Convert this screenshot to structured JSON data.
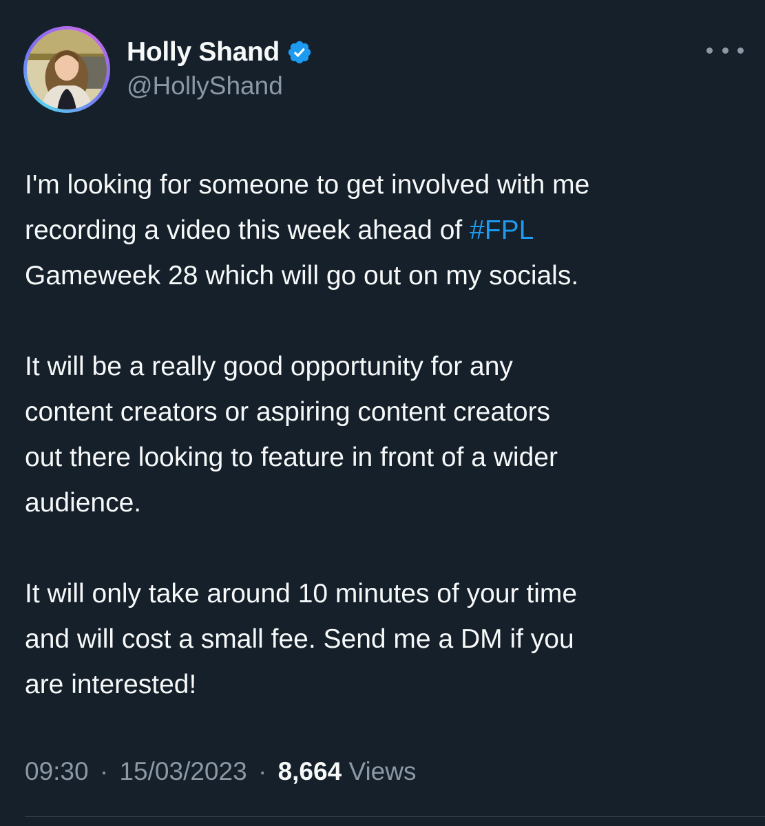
{
  "author": {
    "display_name": "Holly Shand",
    "handle": "@HollyShand",
    "verified": true,
    "avatar_icon": "profile-photo",
    "avatar_ring_colors": [
      "#58d0f0",
      "#7b6ff2",
      "#c96be6"
    ]
  },
  "more_icon": "ellipsis-horizontal-icon",
  "tweet": {
    "paragraph1": {
      "line1": "I'm looking for someone to get involved with me",
      "line2_text": "recording a video this week ahead of ",
      "line2_hashtag": "#FPL",
      "line3": "Gameweek 28 which will go out on my socials."
    },
    "paragraph2": {
      "line1": "It will be a really good opportunity for any",
      "line2": "content creators or aspiring content creators",
      "line3": "out there looking to feature in front of a wider",
      "line4": "audience."
    },
    "paragraph3": {
      "line1": "It will only take around 10 minutes of your time",
      "line2": "and will cost a small fee. Send me a DM if you",
      "line3": "are interested!"
    }
  },
  "meta": {
    "time": "09:30",
    "separator": "·",
    "date": "15/03/2023",
    "views_count": "8,664",
    "views_label": "Views"
  },
  "colors": {
    "background": "#15202b",
    "text": "#f7f9f9",
    "secondary_text": "#8b98a5",
    "link": "#1d9bf0",
    "verified_badge": "#1d9bf0"
  }
}
